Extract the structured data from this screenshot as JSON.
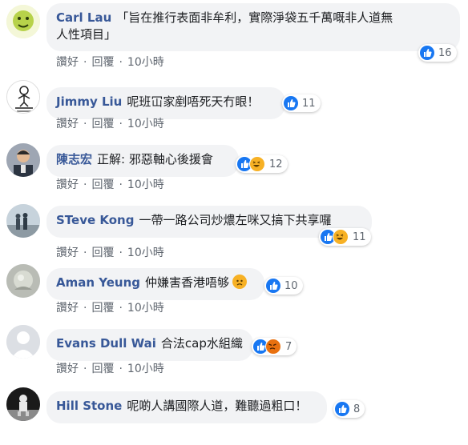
{
  "comments": [
    {
      "author": "Carl Lau",
      "text_line1": "「旨在推行表面非牟利，實際淨袋五千萬嘅非人道無",
      "text_line2": "人性項目」",
      "like_label": "讚好",
      "reply_label": "回覆",
      "time": "10小時",
      "reaction_count": "16"
    },
    {
      "author": "Jimmy Liu",
      "text": "呢班冚家剷唔死天冇眼！",
      "like_label": "讚好",
      "reply_label": "回覆",
      "time": "10小時",
      "reaction_count": "11"
    },
    {
      "author": "陳志宏",
      "text": "正解: 邪惡軸心後援會",
      "like_label": "讚好",
      "reply_label": "回覆",
      "time": "10小時",
      "reaction_count": "12"
    },
    {
      "author": "STeve Kong",
      "text": "一帶一路公司炒燶左咪又搞下共享囉",
      "like_label": "讚好",
      "reply_label": "回覆",
      "time": "10小時",
      "reaction_count": "11"
    },
    {
      "author": "Aman Yeung",
      "text": "仲嫌害香港唔够",
      "like_label": "讚好",
      "reply_label": "回覆",
      "time": "10小時",
      "reaction_count": "10"
    },
    {
      "author": "Evans Dull Wai",
      "text": "合法cap水組織",
      "like_label": "讚好",
      "reply_label": "回覆",
      "time": "10小時",
      "reaction_count": "7"
    },
    {
      "author": "Hill Stone",
      "text": "呢啲人講國際人道，難聽過粗口！",
      "like_label": "讚好",
      "reply_label": "回覆",
      "time": "10小時",
      "reaction_count": "8"
    }
  ],
  "colors": {
    "author": "#385898",
    "bubble": "#f2f3f5",
    "like": "#1877f2",
    "emoji": "#f7b125"
  },
  "icons": [
    "like-icon",
    "haha-icon",
    "sad-icon",
    "angry-icon"
  ]
}
